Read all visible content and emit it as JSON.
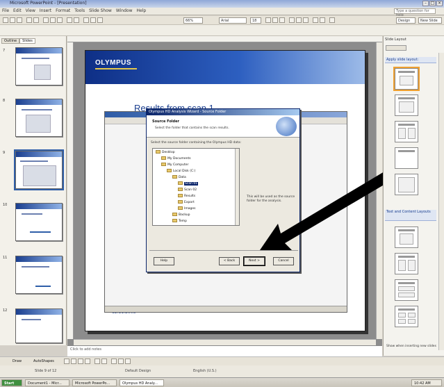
{
  "window": {
    "title": "Microsoft PowerPoint - [Presentation]"
  },
  "menu": [
    "File",
    "Edit",
    "View",
    "Insert",
    "Format",
    "Tools",
    "Slide Show",
    "Window",
    "Help"
  ],
  "help_box": "Type a question for help",
  "toolbar": {
    "font_name": "Arial",
    "font_size": "18",
    "design_label": "Design",
    "new_slide_label": "New Slide",
    "zoom": "66%"
  },
  "left_pane": {
    "tabs": [
      "Outline",
      "Slides"
    ],
    "slide_numbers": [
      "7",
      "8",
      "9",
      "10",
      "11",
      "12"
    ]
  },
  "slide": {
    "logo": "OLYMPUS",
    "title": "Results from scan 1",
    "footer": "12.11.2008"
  },
  "dialog": {
    "title": "Olympus HD Analysis Wizard - Source Folder",
    "header_title": "Source Folder",
    "header_subtitle": "Select the folder that contains the scan results.",
    "instruction": "Select the source folder containing the Olympus HD data:",
    "tree": [
      "Desktop",
      "My Documents",
      "My Computer",
      "Local Disk (C:)",
      "Data",
      "Scan 01",
      "Scan 02",
      "Results",
      "Export",
      "Images",
      "Backup",
      "Temp"
    ],
    "note": "This will be used as the source folder for the analysis.",
    "buttons": {
      "help": "Help",
      "back": "< Back",
      "next": "Next >",
      "cancel": "Cancel"
    }
  },
  "task_pane": {
    "title": "Slide Layout",
    "section_text": "Apply slide layout:",
    "section_content": "Text and Content Layouts",
    "show_when_inserting": "Show when inserting new slides"
  },
  "notes": {
    "placeholder": "Click to add notes"
  },
  "draw_bar": {
    "draw_label": "Draw",
    "autoshapes_label": "AutoShapes"
  },
  "info_bar": {
    "slide_indicator": "Slide 9 of 12",
    "design": "Default Design",
    "language": "English (U.S.)"
  },
  "taskbar": {
    "start": "Start",
    "items": [
      "Document1 - Micr...",
      "Microsoft PowerPo...",
      "Olympus HD Analy..."
    ],
    "clock": "10:42 AM"
  },
  "colors": {
    "slide_band_dark": "#0e2f86",
    "slide_band_light": "#9dbbe8",
    "selection": "#0a246a",
    "arrow": "#000000"
  }
}
